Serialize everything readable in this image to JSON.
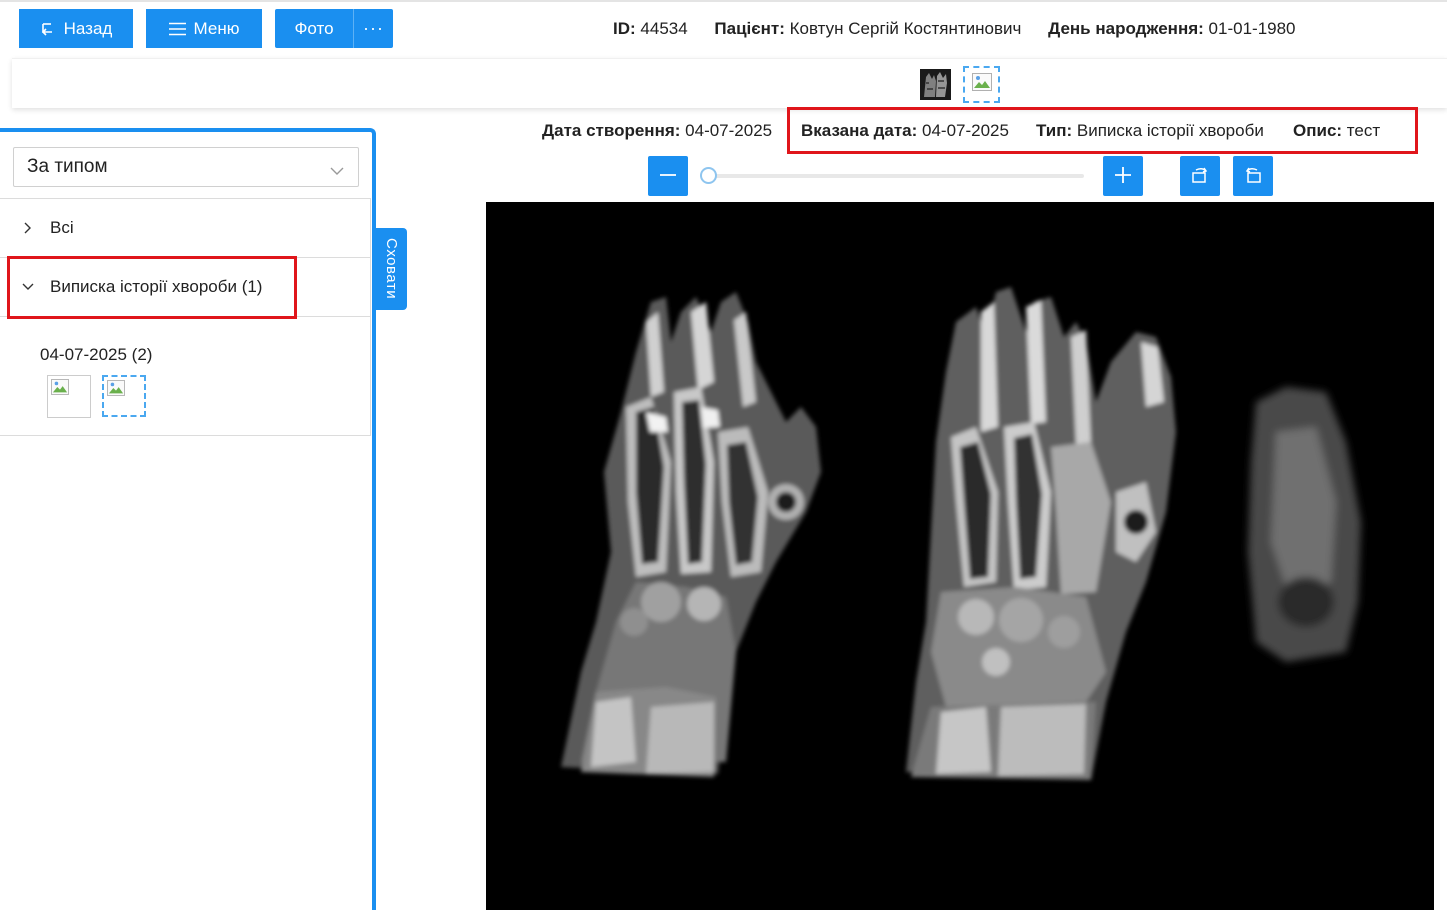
{
  "toolbar": {
    "back_label": "Назад",
    "menu_label": "Меню",
    "photo_label": "Фото",
    "more_label": "···"
  },
  "patient": {
    "id_label": "ID:",
    "id_value": "44534",
    "name_label": "Пацієнт:",
    "name_value": "Ковтун Сергій Костянтинович",
    "dob_label": "День народження:",
    "dob_value": "01-01-1980"
  },
  "sidebar": {
    "filter_value": "За типом",
    "hide_label": "Сховати",
    "tree": [
      {
        "label": "Всі",
        "expanded": false
      },
      {
        "label": "Виписка історії хвороби (1)",
        "expanded": true
      }
    ],
    "date_group": "04-07-2025 (2)"
  },
  "document": {
    "created_label": "Дата створення:",
    "created_value": "04-07-2025",
    "date_label": "Вказана дата:",
    "date_value": "04-07-2025",
    "type_label": "Тип:",
    "type_value": "Виписка історії хвороби",
    "desc_label": "Опис:",
    "desc_value": "тест"
  },
  "zoom": {
    "level": 0
  },
  "colors": {
    "primary": "#1a8ff0",
    "highlight": "#e0161b"
  },
  "icons": [
    "back-icon",
    "menu-icon",
    "chevron-down-icon",
    "chevron-right-icon",
    "minus-icon",
    "plus-icon",
    "rotate-left-icon",
    "rotate-right-icon",
    "broken-image-icon"
  ]
}
